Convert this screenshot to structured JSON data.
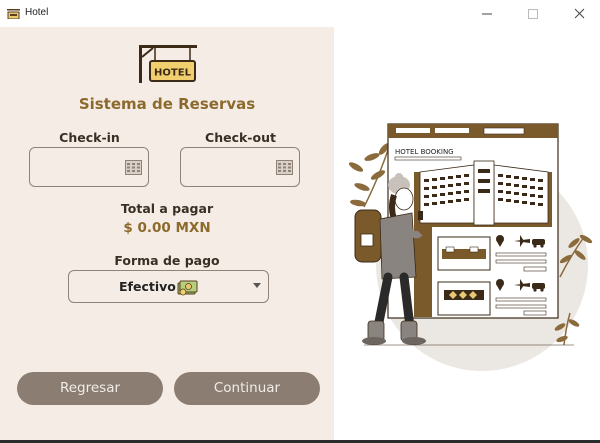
{
  "window": {
    "title": "Hotel",
    "icon": "hotel-sign-icon",
    "controls": [
      "minimize-icon",
      "maximize-icon",
      "close-icon"
    ]
  },
  "header": {
    "logo_text": "HOTEL",
    "title": "Sistema de Reservas"
  },
  "form": {
    "checkin": {
      "label": "Check-in",
      "value": "",
      "icon": "calendar-icon"
    },
    "checkout": {
      "label": "Check-out",
      "value": "",
      "icon": "calendar-icon"
    },
    "total": {
      "label": "Total a pagar",
      "value": "$ 0.00 MXN"
    },
    "payment": {
      "label": "Forma de pago",
      "selected": "Efectivo",
      "icon": "cash-icon"
    }
  },
  "actions": {
    "back_label": "Regresar",
    "continue_label": "Continuar"
  },
  "illustration": {
    "sign_text": "HOTEL BOOKING",
    "icons": [
      "location-pin-icon",
      "plane-icon",
      "car-icon"
    ]
  },
  "colors": {
    "panel_bg": "#f5ede5",
    "accent": "#8c6a2e",
    "button_bg": "#8b7d72",
    "button_text": "#f1ece7",
    "input_border": "#8f8378",
    "illustration_brown": "#7a5a2a"
  }
}
